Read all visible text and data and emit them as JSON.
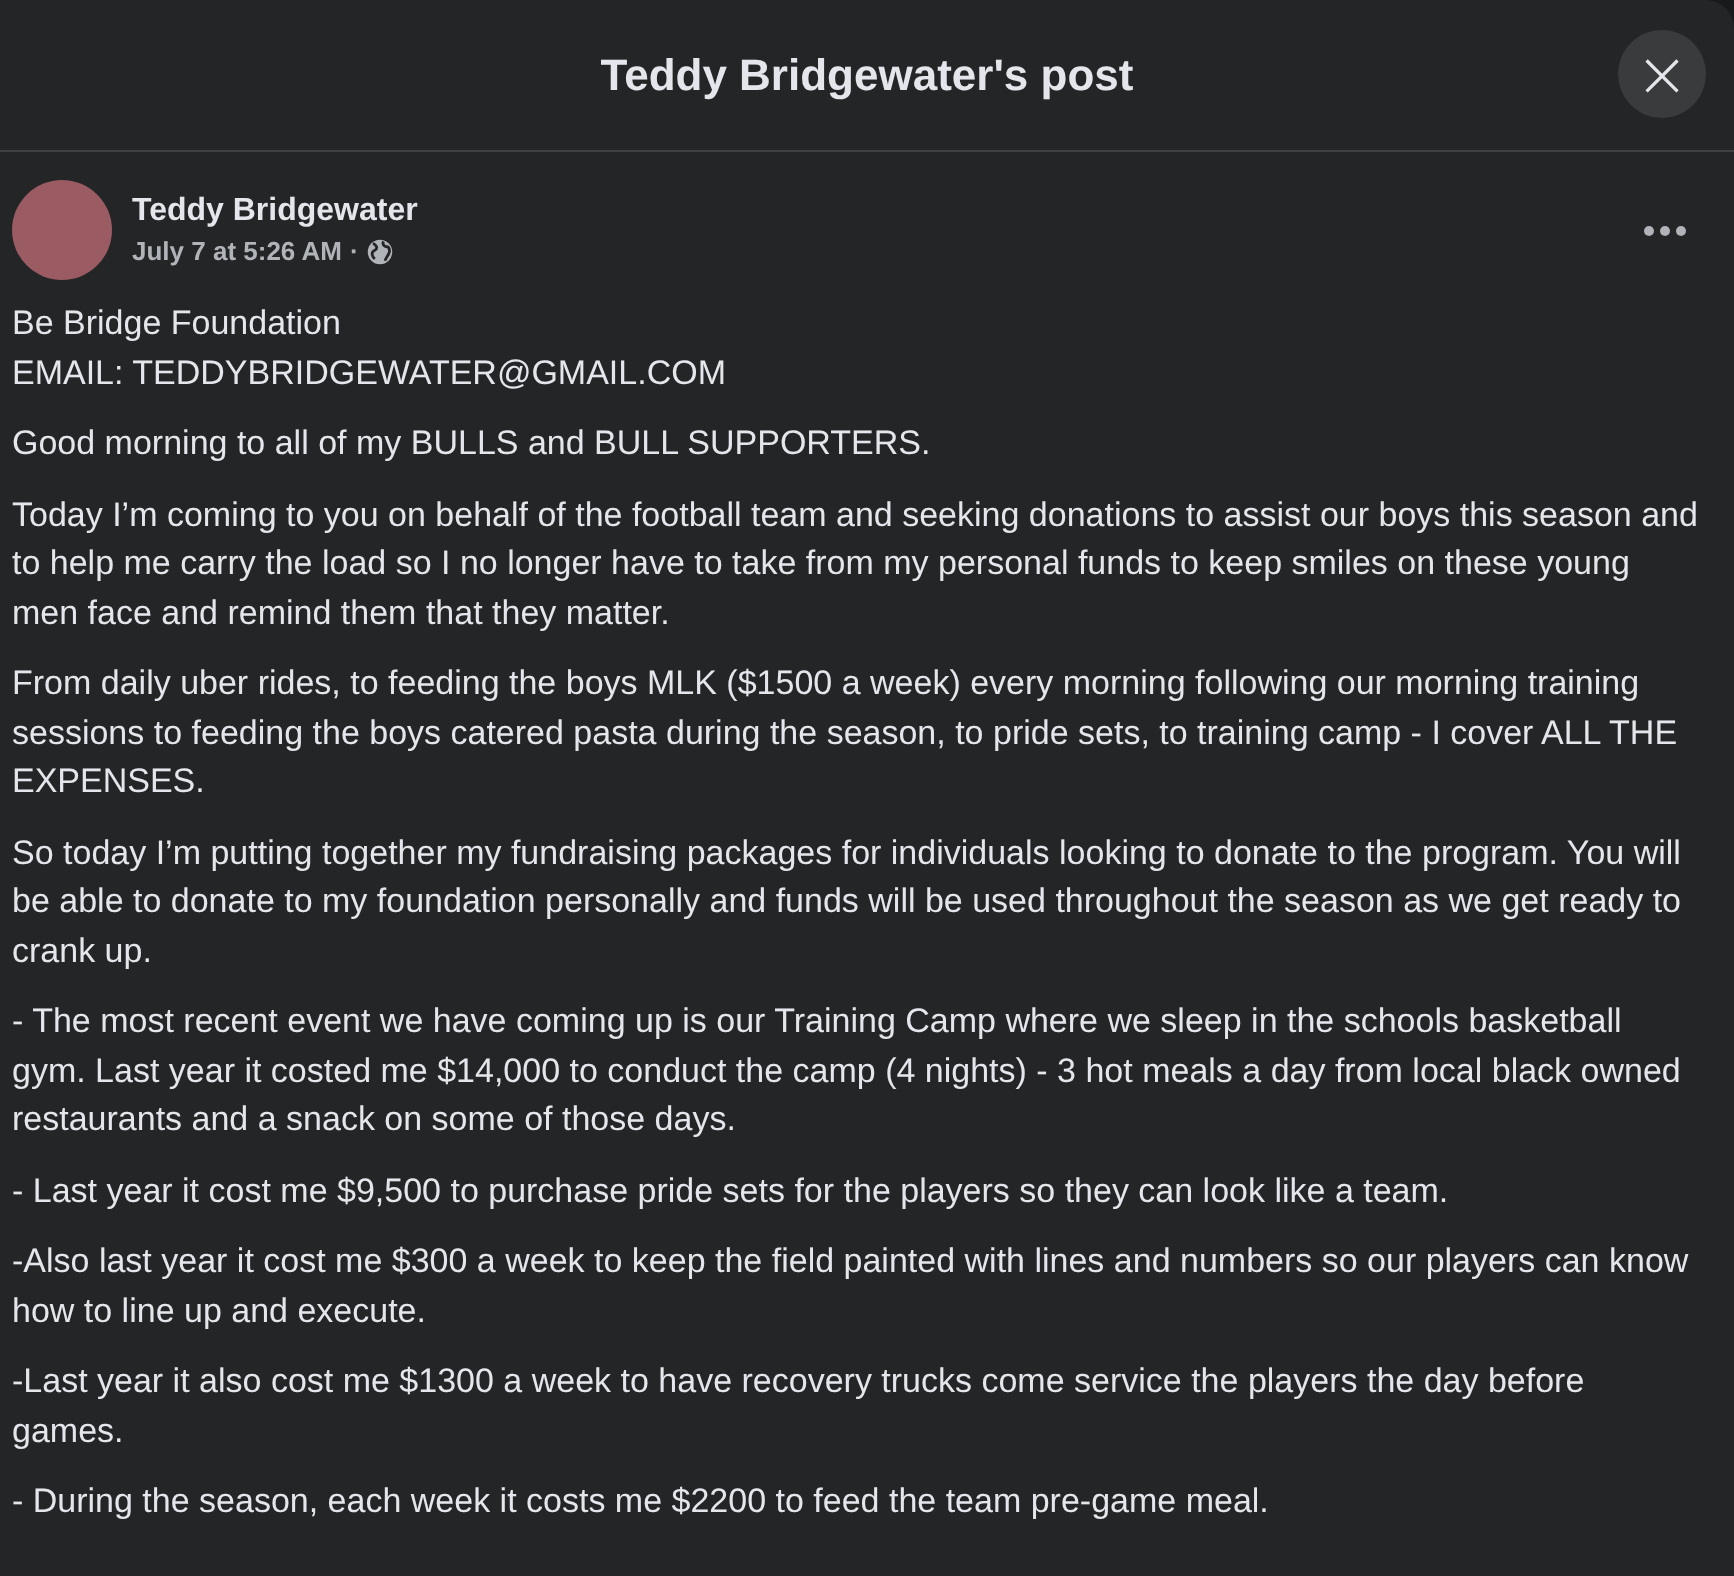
{
  "dialog": {
    "title": "Teddy Bridgewater's post",
    "close": "×"
  },
  "post": {
    "author": "Teddy Bridgewater",
    "time": "July 7 at 5:26 AM",
    "separator": "·",
    "public": true,
    "paragraphs": [
      "Be Bridge Foundation\nEMAIL: TEDDYBRIDGEWATER@GMAIL.COM",
      "Good morning to all of my BULLS and BULL SUPPORTERS.",
      "Today I’m coming to you on behalf of the football team and seeking donations to assist our boys this season and to help me carry the load so I no longer have to take from my personal funds to keep smiles on these young men face and remind them that they matter.",
      "From daily uber rides, to feeding the boys MLK ($1500 a week) every morning following our morning training sessions to feeding the boys catered pasta during the season, to pride sets, to training camp - I cover ALL THE EXPENSES.",
      "So today I’m putting together my fundraising packages for individuals looking to donate to the program. You will be able to donate to my foundation personally and funds will be used throughout the season as we get ready to crank up.",
      "- The most recent event we have coming up is our Training Camp where we sleep in the schools basketball gym. Last year it costed me $14,000 to conduct the camp (4 nights) - 3 hot meals a day from local black owned restaurants and a snack on some of those days.",
      "- Last year it cost me $9,500 to purchase pride sets for the players so they can look like a team.",
      "-Also last year it cost me $300 a week to keep the field painted with lines and numbers so our players can know how to line up and execute.",
      "-Last year it also cost me $1300 a week to have recovery trucks come service the players the day before games.",
      "- During the season, each week it costs me $2200 to feed the team pre-game meal."
    ]
  }
}
